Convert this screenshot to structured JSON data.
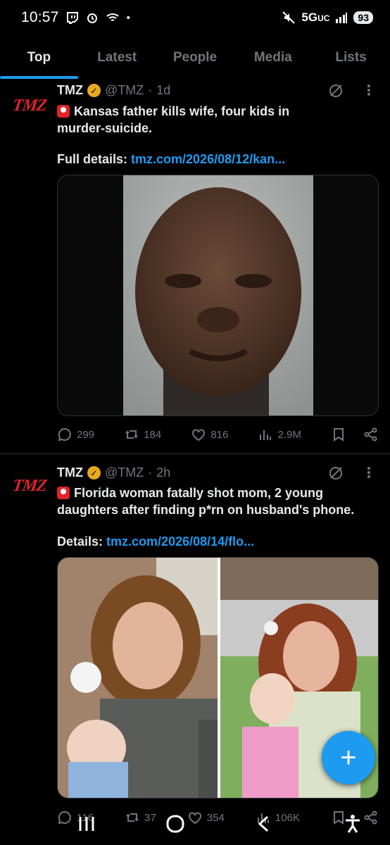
{
  "status_bar": {
    "time": "10:57",
    "network": "5G",
    "network_sub": "UC",
    "battery": "93"
  },
  "tabs": [
    {
      "label": "Top",
      "active": true
    },
    {
      "label": "Latest",
      "active": false
    },
    {
      "label": "People",
      "active": false
    },
    {
      "label": "Media",
      "active": false
    },
    {
      "label": "Lists",
      "active": false
    }
  ],
  "tweets": [
    {
      "avatar_logo": "TMZ",
      "name": "TMZ",
      "handle": "@TMZ",
      "separator": "·",
      "time": "1d",
      "line1": "Kansas father kills wife, four kids in",
      "line2": "murder-suicide.",
      "link_prefix": "Full details:",
      "link": "tmz.com/2026/08/12/kan...",
      "metrics": {
        "replies": "299",
        "reposts": "184",
        "likes": "816",
        "views": "2.9M"
      }
    },
    {
      "avatar_logo": "TMZ",
      "name": "TMZ",
      "handle": "@TMZ",
      "separator": "·",
      "time": "2h",
      "line1": "Florida woman fatally shot mom, 2 young",
      "line2": "daughters after finding p*rn on husband's phone.",
      "link_prefix": "Details:",
      "link": "tmz.com/2026/08/14/flo...",
      "metrics": {
        "replies": "116",
        "reposts": "37",
        "likes": "354",
        "views": "106K"
      }
    }
  ],
  "fab": {
    "label": "+"
  },
  "colors": {
    "accent": "#1d9bf0",
    "brand_red": "#e0242a",
    "verified_gold": "#e8a920"
  }
}
